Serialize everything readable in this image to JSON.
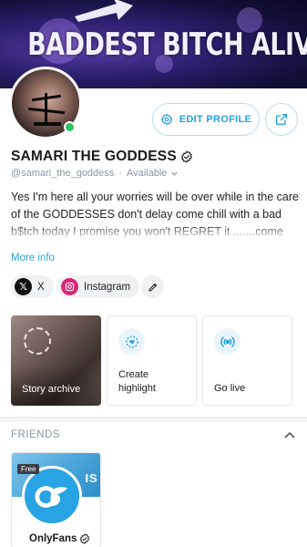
{
  "banner": {
    "text": "BADDEST BITCH ALIV"
  },
  "profile": {
    "name": "SAMARI THE GODDESS",
    "handle": "@samari_the_goddess",
    "separator": "·",
    "status": "Available",
    "bio": "Yes I'm here all your worries will be over while in the care of the GODDESSES don't delay come chill with a bad b$tch today I promise you won't REGRET it .......come see",
    "more_info": "More info"
  },
  "actions": {
    "edit_profile": "EDIT PROFILE"
  },
  "social": [
    {
      "icon": "x-logo-icon",
      "label": "X"
    },
    {
      "icon": "instagram-icon",
      "label": "Instagram"
    }
  ],
  "cards": {
    "story_archive": "Story archive",
    "create_highlight": "Create highlight",
    "go_live": "Go live"
  },
  "friends": {
    "title": "FRIENDS",
    "items": [
      {
        "name": "OnlyFans",
        "badge": "Free",
        "cover_text": "ıs"
      }
    ]
  },
  "colors": {
    "accent": "#2aa0dc",
    "online": "#2fc46a",
    "instagram": "#d62976"
  }
}
